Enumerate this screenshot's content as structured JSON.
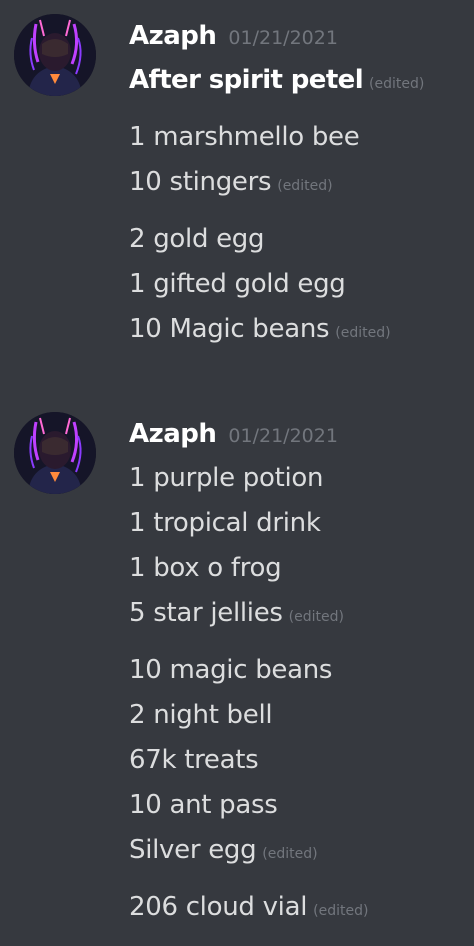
{
  "messages": [
    {
      "author": "Azaph",
      "timestamp": "01/21/2021",
      "lines": [
        {
          "text": "After spirit petel",
          "edited": "(edited)"
        },
        {
          "text": "1 marshmello bee"
        },
        {
          "text": "10 stingers",
          "edited": "(edited)"
        },
        {
          "text": "2 gold egg"
        },
        {
          "text": "1 gifted gold egg"
        },
        {
          "text": "10 Magic beans",
          "edited": "(edited)"
        }
      ]
    },
    {
      "author": "Azaph",
      "timestamp": "01/21/2021",
      "lines": [
        {
          "text": "1 purple potion"
        },
        {
          "text": "1 tropical drink"
        },
        {
          "text": "1 box o frog"
        },
        {
          "text": "5 star jellies",
          "edited": "(edited)"
        },
        {
          "text": "10 magic beans"
        },
        {
          "text": "2 night bell"
        },
        {
          "text": "67k treats"
        },
        {
          "text": "10 ant pass"
        },
        {
          "text": "Silver egg",
          "edited": "(edited)"
        },
        {
          "text": "206 cloud vial",
          "edited": "(edited)"
        }
      ]
    }
  ],
  "colors": {
    "background": "#36393f",
    "username": "#ffffff",
    "body_text": "#dcddde",
    "muted": "#72767d",
    "avatar_accent": "#b84dff"
  },
  "icons": {
    "avatar": "user-avatar-image"
  }
}
